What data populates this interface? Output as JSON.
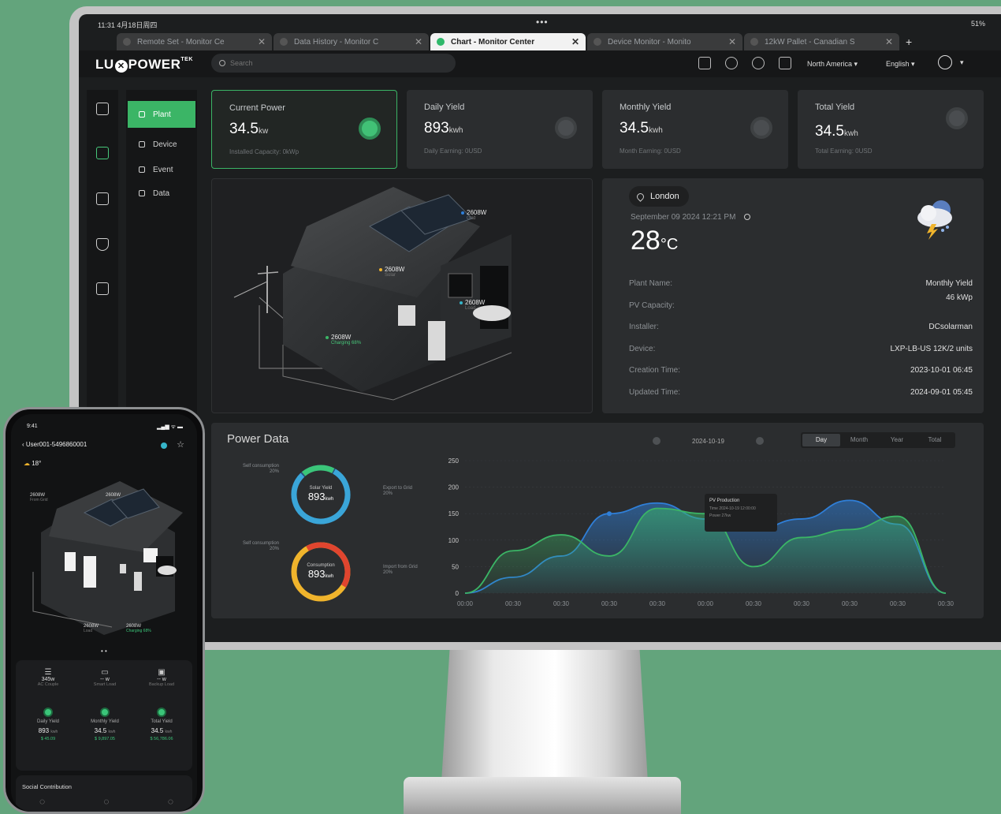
{
  "browser": {
    "status_time": "11:31  4月18日周四",
    "status_right": "51%",
    "tabs": [
      {
        "label": "Remote Set - Monitor Ce",
        "active": false
      },
      {
        "label": "Data History - Monitor C",
        "active": false
      },
      {
        "label": "Chart - Monitor Center",
        "active": true
      },
      {
        "label": "Device Monitor - Monito",
        "active": false
      },
      {
        "label": "12kW Pallet - Canadian S",
        "active": false
      }
    ],
    "new_tab": "+"
  },
  "header": {
    "logo_a": "LU",
    "logo_b": "POWER",
    "logo_tm": "TEK",
    "search_placeholder": "Search",
    "region": "North America ▾",
    "language": "English ▾"
  },
  "sidebar": {
    "rail_icons": [
      "monitor-icon",
      "battery-icon",
      "lock-icon",
      "shield-icon",
      "chart-icon"
    ],
    "items": [
      {
        "label": "Plant",
        "active": true
      },
      {
        "label": "Device",
        "active": false
      },
      {
        "label": "Event",
        "active": false
      },
      {
        "label": "Data",
        "active": false
      }
    ]
  },
  "cards": [
    {
      "title": "Current Power",
      "value": "34.5",
      "unit": "kw",
      "sub": "Installed Capacity: 0kWp",
      "icon": "power-icon",
      "selected": true
    },
    {
      "title": "Daily Yield",
      "value": "893",
      "unit": "kwh",
      "sub": "Daily Earning: 0USD",
      "icon": "daily-chart-icon",
      "selected": false
    },
    {
      "title": "Monthly Yield",
      "value": "34.5",
      "unit": "kwh",
      "sub": "Month Earning: 0USD",
      "icon": "calendar-icon",
      "selected": false
    },
    {
      "title": "Total Yield",
      "value": "34.5",
      "unit": "kwh",
      "sub": "Total Earning: 0USD",
      "icon": "database-icon",
      "selected": false
    }
  ],
  "house": {
    "grid": {
      "value": "2608W",
      "sub": "Grid"
    },
    "solar": {
      "value": "2608W",
      "sub": "Solar"
    },
    "load": {
      "value": "2608W",
      "sub": "Load"
    },
    "battery": {
      "value": "2608W",
      "sub": "Charging 68%"
    }
  },
  "weather": {
    "location": "London",
    "datetime": "September 09 2024 12:21 PM",
    "temp": "28",
    "temp_unit": "°C",
    "icon": "storm-cloud-icon"
  },
  "plant_info": [
    {
      "key": "Plant Name:",
      "value": "Monthly Yield"
    },
    {
      "key": "PV Capacity:",
      "value": "46 kWp"
    },
    {
      "key": "Installer:",
      "value": "DCsolarman"
    },
    {
      "key": "Device:",
      "value": "LXP-LB-US 12K/2 units"
    },
    {
      "key": "Creation Time:",
      "value": "2023-10-01 06:45"
    },
    {
      "key": "Updated Time:",
      "value": "2024-09-01 05:45"
    }
  ],
  "power_data": {
    "title": "Power Data",
    "date": "2024-10-19",
    "ranges": [
      "Day",
      "Month",
      "Year",
      "Total"
    ],
    "active_range": "Day",
    "solar_ring": {
      "label": "Solar Yield",
      "value": "893",
      "unit": "kwh",
      "left_label": "Self consumption",
      "left_pct": "20%",
      "right_label": "Export to Grid",
      "right_pct": "20%"
    },
    "consumption_ring": {
      "label": "Consumption",
      "value": "893",
      "unit": "kwh",
      "left_label": "Self consumption",
      "left_pct": "20%",
      "right_label": "Import from Grid",
      "right_pct": "20%"
    },
    "tooltip": {
      "title": "PV Production",
      "line1": "Time 2024-10-19 12:00:00",
      "line2": "Power 27kw"
    }
  },
  "chart_data": {
    "type": "area",
    "x": [
      "00:00",
      "00:30",
      "00:30",
      "00:30",
      "00:30",
      "00:00",
      "00:30",
      "00:30",
      "00:30",
      "00:30",
      "00:30"
    ],
    "ylim": [
      0,
      250
    ],
    "yticks": [
      0,
      50,
      100,
      150,
      200,
      250
    ],
    "series": [
      {
        "name": "",
        "color": "#2f7fd8",
        "values": [
          0,
          30,
          70,
          150,
          170,
          140,
          120,
          140,
          175,
          130,
          0
        ]
      },
      {
        "name": "",
        "color": "#3bb566",
        "values": [
          0,
          80,
          110,
          70,
          160,
          150,
          50,
          105,
          120,
          145,
          0
        ]
      }
    ],
    "grid": true
  },
  "phone": {
    "time": "9:41",
    "status": "▂▄▆ ᯤ ▬",
    "title": "User001-5496860001",
    "weather": "18°",
    "labels": {
      "grid": {
        "value": "2608W",
        "sub": "From Grid"
      },
      "solar": {
        "value": "2608W",
        "sub": "Solar"
      },
      "load": {
        "value": "2608W",
        "sub": "Load"
      },
      "battery": {
        "value": "2608W",
        "sub": "Charging 68%"
      }
    },
    "loads": [
      {
        "value": "345w",
        "label": "AC Couple"
      },
      {
        "value": "-- w",
        "label": "Smart Load"
      },
      {
        "value": "-- w",
        "label": "Backup Load"
      }
    ],
    "yields": [
      {
        "title": "Daily Yield",
        "value": "893",
        "unit": "kwh",
        "money": "$ 45.09"
      },
      {
        "title": "Monthly Yield",
        "value": "34.5",
        "unit": "kwh",
        "money": "$ 9,897.05"
      },
      {
        "title": "Total Yield",
        "value": "34.5",
        "unit": "kwh",
        "money": "$ 56,786.06"
      }
    ],
    "social": "Social Contribution"
  }
}
